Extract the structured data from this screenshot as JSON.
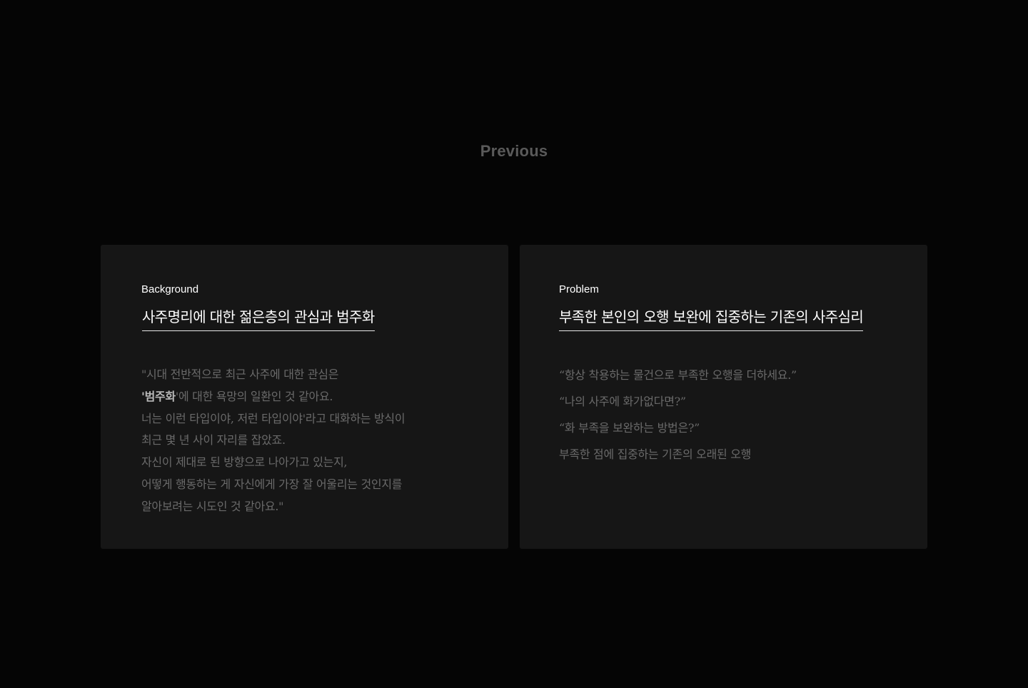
{
  "section": {
    "title": "Previous"
  },
  "cards": {
    "background": {
      "label": "Background",
      "heading": "사주명리에 대한 젊은층의 관심과 범주화",
      "lines": [
        "\"시대 전반적으로 최근 사주에 대한 관심은",
        {
          "prefix": "'",
          "strong": "범주화",
          "suffix": "'에 대한 욕망의 일환인 것 같아요."
        },
        "너는 이런 타입이야, 저런 타입이야'라고 대화하는 방식이",
        "최근 몇 년 사이 자리를 잡았죠.",
        "자신이 제대로 된 방향으로 나아가고 있는지,",
        "어떻게 행동하는 게 자신에게 가장 잘 어울리는 것인지를",
        "알아보려는 시도인 것 같아요.\""
      ]
    },
    "problem": {
      "label": "Problem",
      "heading": "부족한 본인의 오행 보완에 집중하는 기존의 사주심리",
      "lines": [
        "“항상 착용하는 물건으로 부족한 오행을 더하세요.”",
        "“나의 사주에 화가없다면?”",
        "“화 부족을 보완하는 방법은?”",
        "부족한 점에 집중하는 기존의 오래된 오행"
      ]
    }
  },
  "colors": {
    "page_background": "#050505",
    "card_background": "#161616",
    "title_gray": "#5a5a5a",
    "body_gray": "#6a6a6a",
    "heading_white": "#ffffff"
  }
}
